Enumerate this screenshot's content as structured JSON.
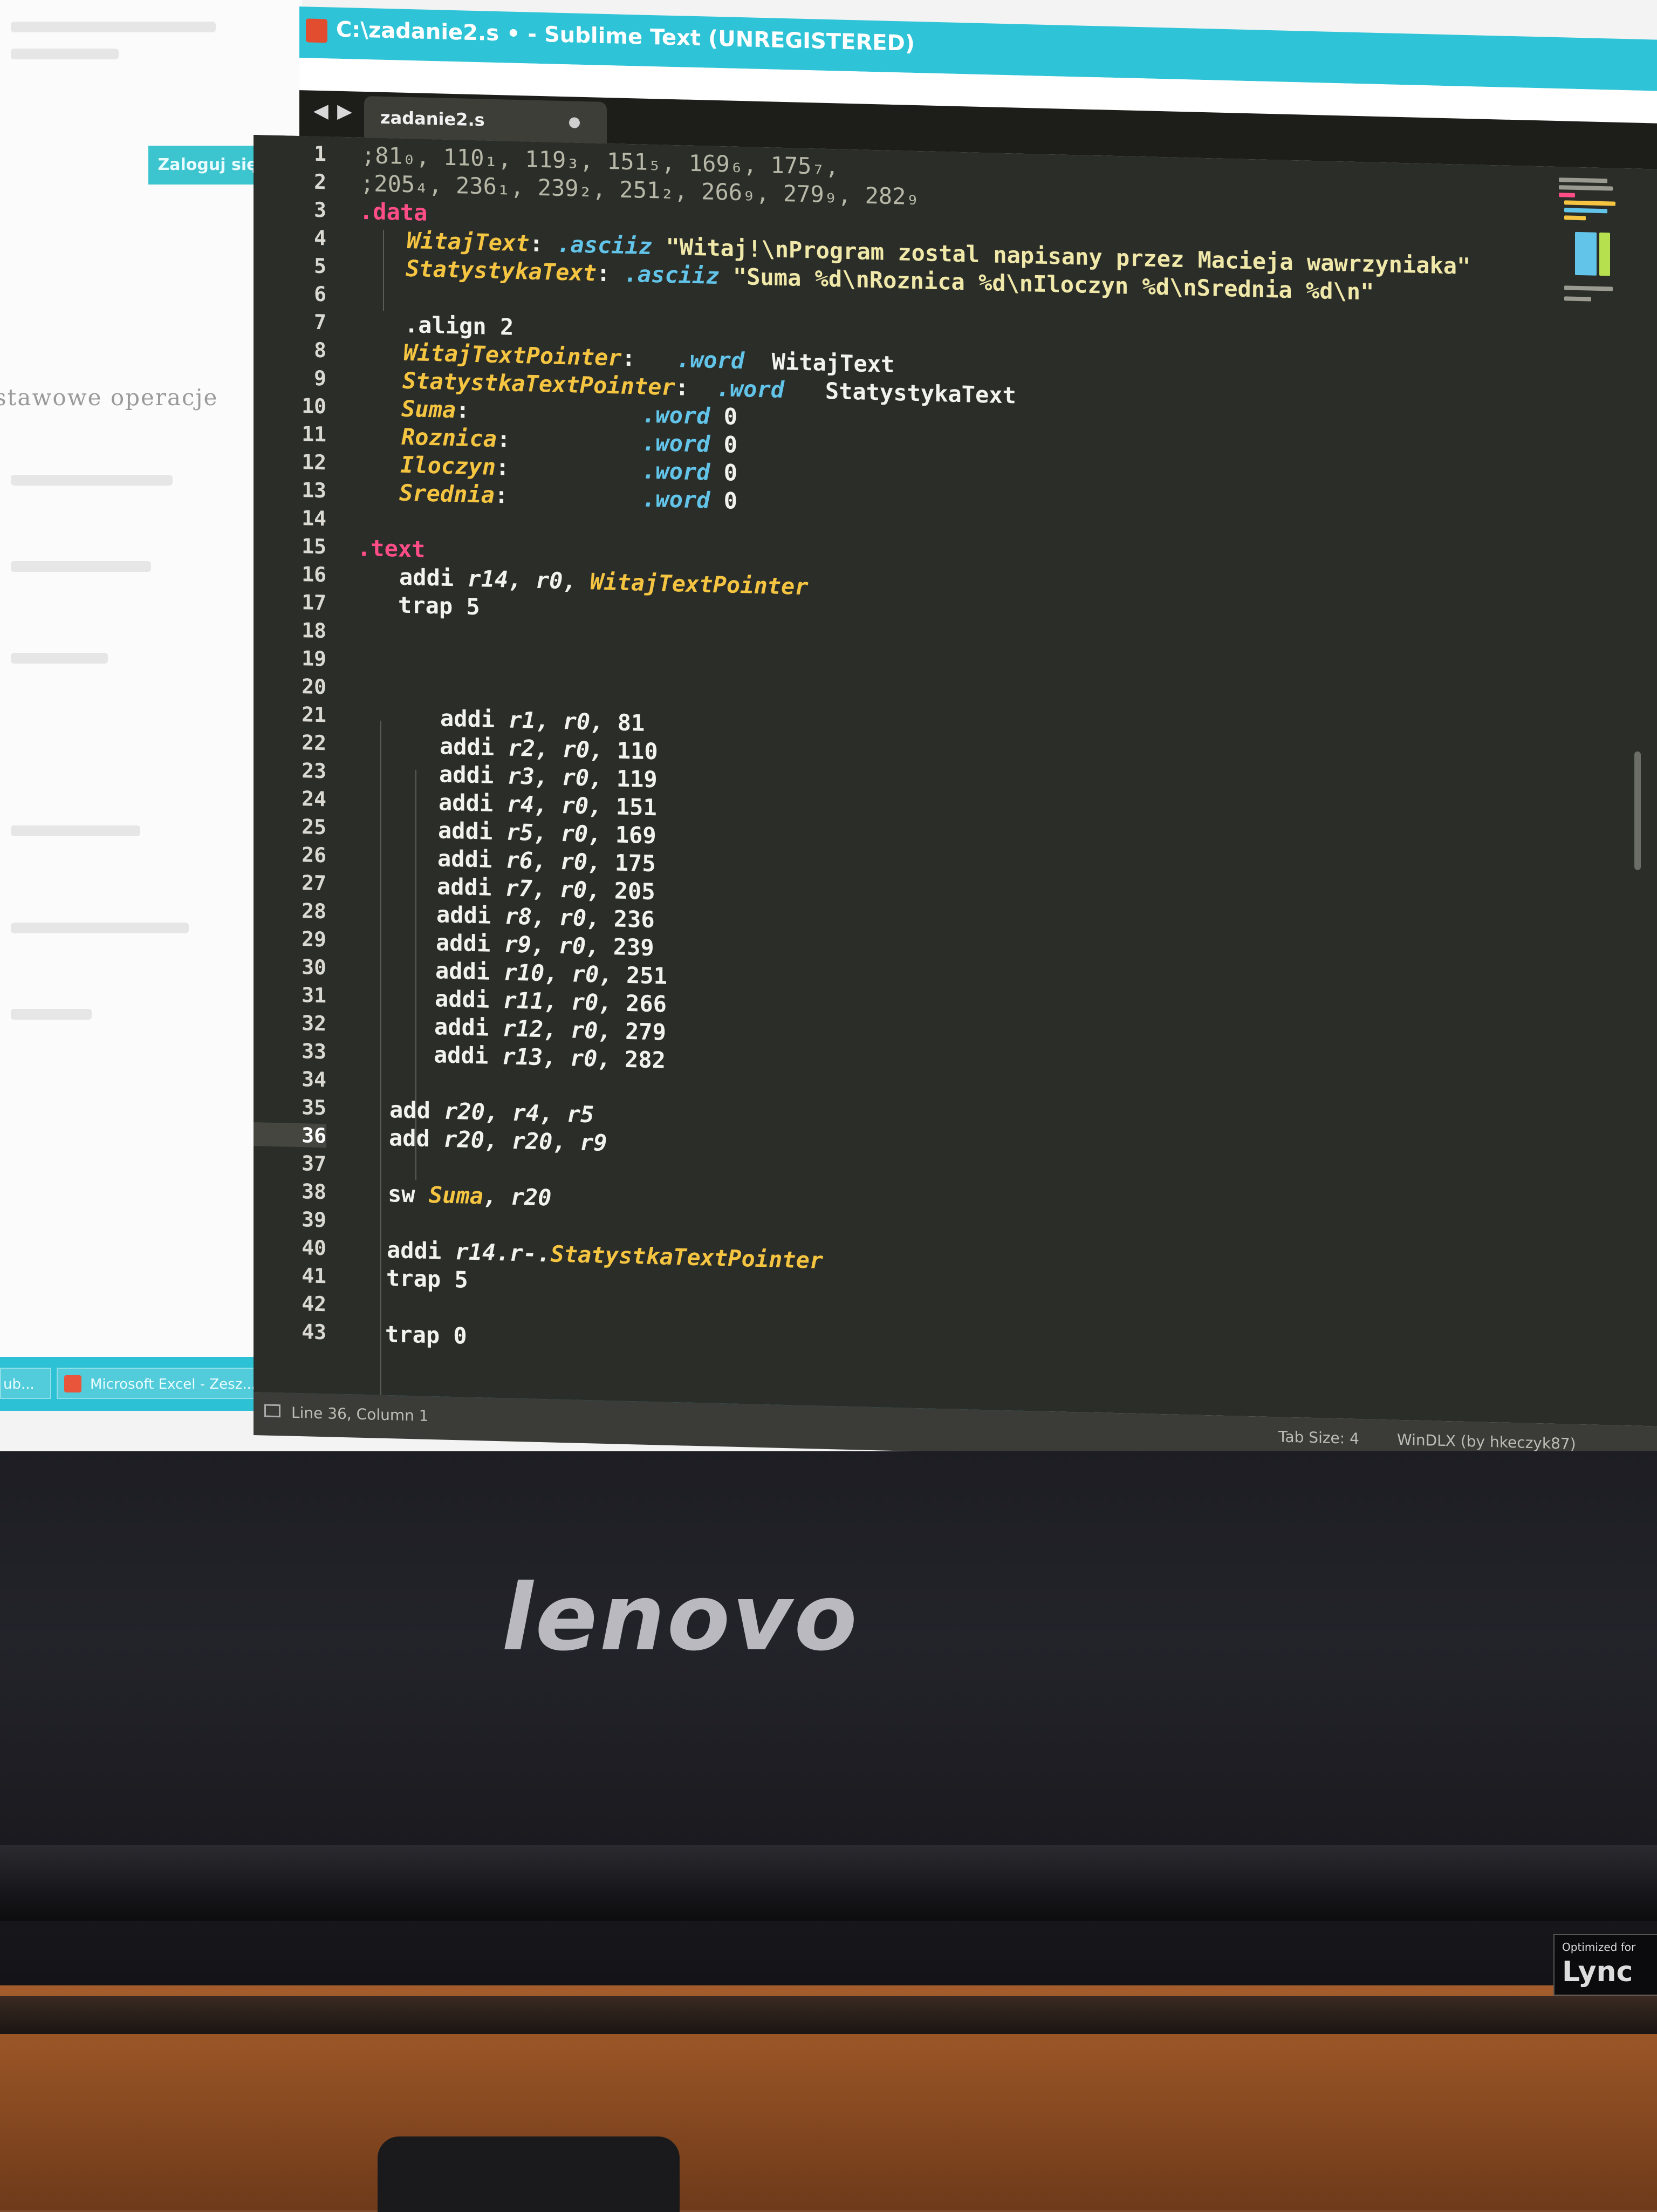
{
  "window": {
    "title": "C:\\zadanie2.s • - Sublime Text (UNREGISTERED)",
    "tab_label": "zadanie2.s",
    "nav_back": "◀",
    "nav_forward": "▶"
  },
  "background_page": {
    "login_button": "Zaloguj się",
    "partial_text": "stawowe operacje"
  },
  "taskbar": {
    "items": [
      {
        "label": "ub..."
      },
      {
        "label": "Microsoft Excel - Zesz..."
      }
    ]
  },
  "statusbar": {
    "position": "Line 36, Column 1",
    "tab_size": "Tab Size: 4",
    "syntax": "WinDLX (by hkeczyk87)"
  },
  "editor": {
    "active_line": 36,
    "line_numbers": [
      "1",
      "2",
      "3",
      "4",
      "5",
      "6",
      "7",
      "8",
      "9",
      "10",
      "11",
      "12",
      "13",
      "14",
      "15",
      "16",
      "17",
      "18",
      "19",
      "20",
      "21",
      "22",
      "23",
      "24",
      "25",
      "26",
      "27",
      "28",
      "29",
      "30",
      "31",
      "32",
      "33",
      "34",
      "35",
      "36",
      "37",
      "38",
      "39",
      "40",
      "41",
      "42",
      "43"
    ],
    "lines": {
      "l1": ";81₀, 110₁, 119₃, 151₅, 169₆, 175₇,",
      "l2": ";205₄, 236₁, 239₂, 251₂, 266₉, 279₉, 282₉",
      "l3": ".data",
      "l4_label": "WitajText",
      "l4_dir": ".asciiz",
      "l4_str": "\"Witaj!\\nProgram zostal napisany przez Macieja wawrzyniaka\"",
      "l5_label": "StatystykaText",
      "l5_dir": ".asciiz",
      "l5_str": "\"Suma %d\\nRoznica %d\\nIloczyn %d\\nSrednia %d\\n\"",
      "l7": ".align 2",
      "l8_label": "WitajTextPointer",
      "l8_dir": ".word",
      "l8_val": "WitajText",
      "l9_label": "StatystkaTextPointer",
      "l9_dir": ".word",
      "l9_val": "StatystykaText",
      "l10_label": "Suma",
      "l11_label": "Roznica",
      "l12_label": "Iloczyn",
      "l13_label": "Srednia",
      "word_dir": ".word",
      "zero": "0",
      "colon": ":",
      "l15": ".text",
      "l16_op": "addi",
      "l16_regs": "r14, r0,",
      "l16_label": "WitajTextPointer",
      "l17": "trap 5",
      "addi": "addi",
      "l20_regs": "r1, r0,",
      "l20_val": "81",
      "l21_regs": "r2, r0,",
      "l21_val": "110",
      "l22_regs": "r3, r0,",
      "l22_val": "119",
      "l23_regs": "r4, r0,",
      "l23_val": "151",
      "l24_regs": "r5, r0,",
      "l24_val": "169",
      "l25_regs": "r6, r0,",
      "l25_val": "175",
      "l26_regs": "r7, r0,",
      "l26_val": "205",
      "l27_regs": "r8, r0,",
      "l27_val": "236",
      "l28_regs": "r9, r0,",
      "l28_val": "239",
      "l29_regs": "r10, r0,",
      "l29_val": "251",
      "l30_regs": "r11, r0,",
      "l30_val": "266",
      "l31_regs": "r12, r0,",
      "l31_val": "279",
      "l32_regs": "r13, r0,",
      "l32_val": "282",
      "l34_op": "add",
      "l34_regs": "r20, r4, r5",
      "l35_op": "add",
      "l35_regs": "r20, r20, r9",
      "l37_op": "sw",
      "l37_label": "Suma",
      "l37_regs": ", r20",
      "l39_op": "addi",
      "l39_regs": "r14.r-.",
      "l39_label": "StatystkaTextPointer",
      "l40": "trap 5",
      "l42": "trap 0"
    }
  },
  "monitor": {
    "brand": "lenovo",
    "badge_top": "Optimized for",
    "badge_main": "Lync"
  },
  "colors": {
    "editor_bg": "#2b2d29",
    "titlebar": "#2ec3d6",
    "label_yellow": "#f5c542",
    "directive_blue": "#62c4e8",
    "section_pink": "#ff4d88"
  }
}
